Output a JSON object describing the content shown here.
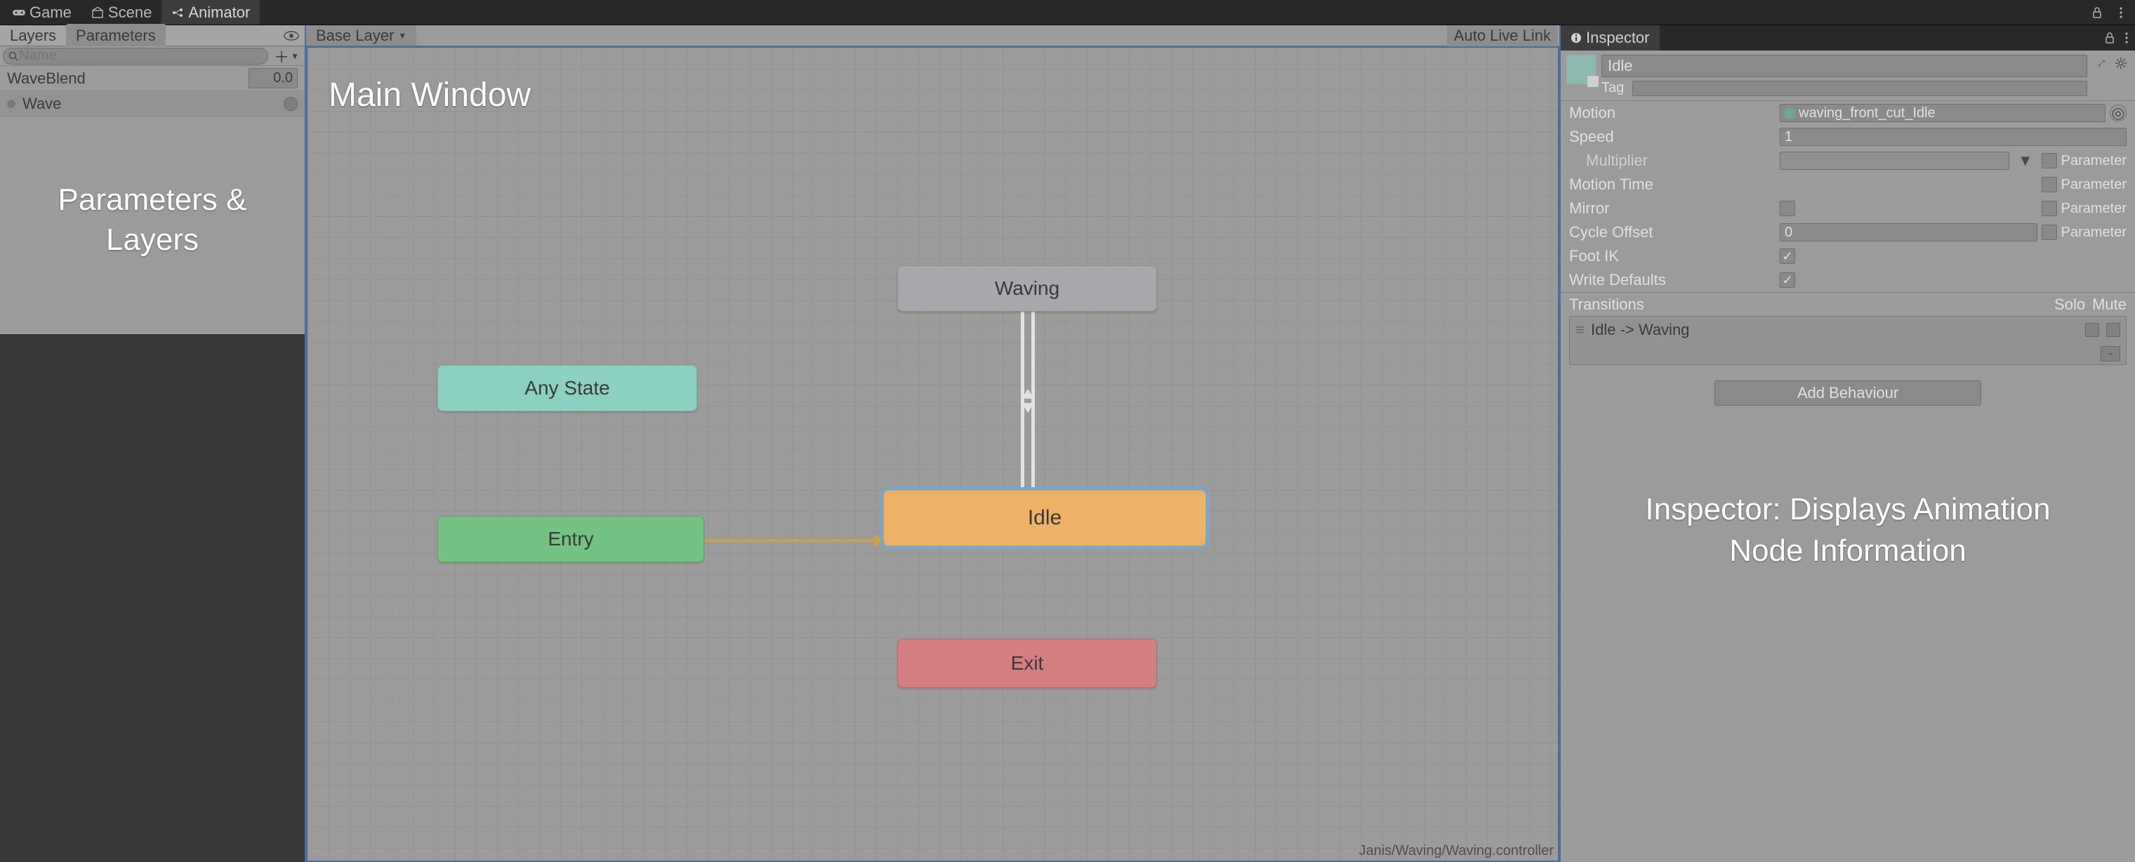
{
  "tabs": {
    "game": "Game",
    "scene": "Scene",
    "animator": "Animator"
  },
  "left": {
    "tab_layers": "Layers",
    "tab_parameters": "Parameters",
    "search_placeholder": "Name",
    "params": [
      {
        "name": "WaveBlend",
        "value": "0.0",
        "type": "float"
      },
      {
        "name": "Wave",
        "value": "",
        "type": "trigger"
      }
    ],
    "overlay_l1": "Parameters &",
    "overlay_l2": "Layers"
  },
  "center": {
    "breadcrumb": "Base Layer",
    "live_link": "Auto Live Link",
    "title": "Main Window",
    "nodes": {
      "waving": "Waving",
      "anystate": "Any State",
      "idle": "Idle",
      "entry": "Entry",
      "exit": "Exit"
    },
    "footer": "Janis/Waving/Waving.controller"
  },
  "inspector": {
    "tab": "Inspector",
    "state_name": "Idle",
    "tag_label": "Tag",
    "tag_value": "",
    "props": {
      "motion": {
        "label": "Motion",
        "value": "waving_front_cut_Idle"
      },
      "speed": {
        "label": "Speed",
        "value": "1"
      },
      "multiplier": {
        "label": "Multiplier",
        "value": "",
        "param_label": "Parameter",
        "param_checked": false
      },
      "motion_time": {
        "label": "Motion Time",
        "value": "",
        "param_label": "Parameter",
        "param_checked": false
      },
      "mirror": {
        "label": "Mirror",
        "checked": false,
        "param_label": "Parameter",
        "param_checked": false
      },
      "cycle_offset": {
        "label": "Cycle Offset",
        "value": "0",
        "param_label": "Parameter",
        "param_checked": false
      },
      "foot_ik": {
        "label": "Foot IK",
        "checked": true
      },
      "write_defaults": {
        "label": "Write Defaults",
        "checked": true
      }
    },
    "transitions": {
      "header": "Transitions",
      "solo": "Solo",
      "mute": "Mute",
      "items": [
        {
          "label": "Idle -> Waving"
        }
      ]
    },
    "add_behaviour": "Add Behaviour",
    "overlay_l1": "Inspector: Displays Animation",
    "overlay_l2": "Node Information"
  }
}
